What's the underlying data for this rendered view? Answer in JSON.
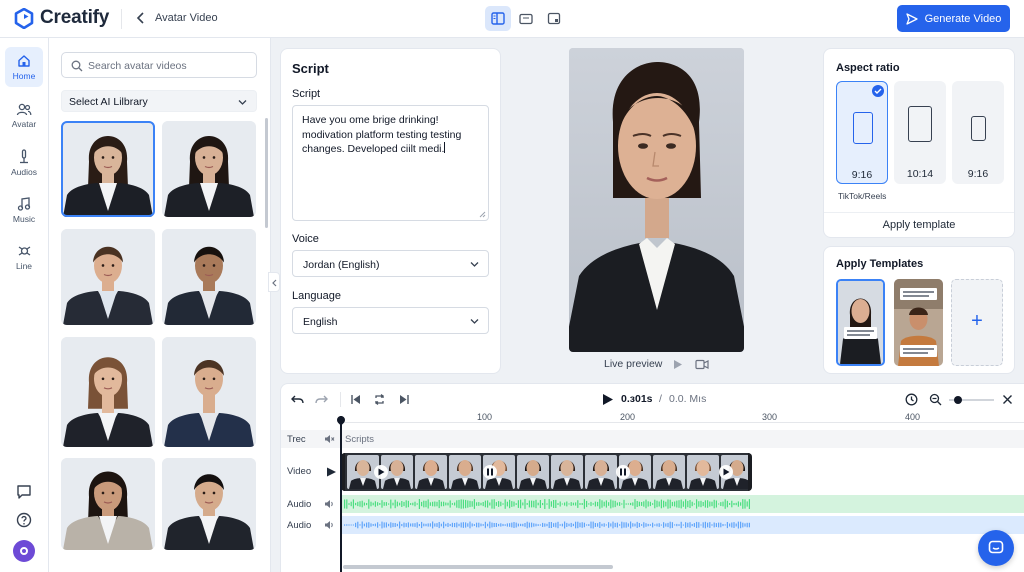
{
  "app": {
    "brand": "Creatify",
    "breadcrumb": "Avatar Video",
    "generate_label": "Generate Video"
  },
  "colors": {
    "accent": "#2563eb",
    "accent_light": "#e6effd",
    "audio_green": "#4ade80",
    "audio_blue": "#60a5fa"
  },
  "rail": {
    "items": [
      {
        "label": "Home",
        "icon": "home-icon",
        "active": true
      },
      {
        "label": "Avatar",
        "icon": "users-icon"
      },
      {
        "label": "Audios",
        "icon": "microphone-icon"
      },
      {
        "label": "Music",
        "icon": "music-note-icon"
      },
      {
        "label": "Line",
        "icon": "line-icon"
      }
    ],
    "bottom_icons": [
      "chat-icon",
      "help-icon",
      "profile-icon"
    ]
  },
  "library": {
    "search_placeholder": "Search avatar videos",
    "select_label": "Select AI Lilbrary",
    "avatars": [
      {
        "skin": "#d9b59a",
        "hair": "#2a1c15",
        "suit": "#1c1f26",
        "shirt": "#f3f4f6",
        "long_hair": true
      },
      {
        "skin": "#d8b196",
        "hair": "#1f1612",
        "suit": "#1d2027",
        "shirt": "#f3f4f6",
        "long_hair": true
      },
      {
        "skin": "#dcae8f",
        "hair": "#4a3222",
        "suit": "#262b36",
        "shirt": "#dfe6ee",
        "long_hair": false
      },
      {
        "skin": "#a97a5a",
        "hair": "#17110e",
        "suit": "#222936",
        "shirt": "#e5e7eb",
        "long_hair": false
      },
      {
        "skin": "#e2b99c",
        "hair": "#7a5237",
        "suit": "#1f222a",
        "shirt": "#f3f4f6",
        "long_hair": true
      },
      {
        "skin": "#d9ad8e",
        "hair": "#4c3424",
        "suit": "#23304a",
        "shirt": "#e5e7eb",
        "long_hair": false
      },
      {
        "skin": "#c99a7b",
        "hair": "#1d1410",
        "suit": "#b9b2a8",
        "shirt": "#f3f4f6",
        "long_hair": true
      },
      {
        "skin": "#d5ab8c",
        "hair": "#141010",
        "suit": "#20242c",
        "shirt": "#f3f4f6",
        "long_hair": false
      }
    ]
  },
  "script_panel": {
    "title": "Script",
    "script_label": "Script",
    "script_text": "Have you ome brige drinking! modivation platform testing testing changes. Developed ciilt medi.",
    "voice_label": "Voice",
    "voice_value": "Jordan (English)",
    "language_label": "Language",
    "language_value": "English"
  },
  "preview": {
    "label": "Live preview"
  },
  "aspect": {
    "title": "Aspect ratio",
    "options": [
      {
        "label": "9:16",
        "selected": true,
        "caption": "TikTok/Reels"
      },
      {
        "label": "10:14",
        "selected": false,
        "caption": ""
      },
      {
        "label": "9:16",
        "selected": false,
        "caption": ""
      }
    ],
    "apply_label": "Apply template"
  },
  "templates": {
    "title": "Apply Templates",
    "add_label": "+"
  },
  "timeline": {
    "time": "0.з01s",
    "separator": "/",
    "duration": "0.0. Mıs",
    "ticks": [
      "100",
      "200",
      "300",
      "400"
    ],
    "zoom_level": 0.2,
    "tracks": [
      {
        "label": "Trec",
        "clip_label": "Scripts",
        "kind": "text"
      },
      {
        "label": "Video",
        "kind": "video"
      },
      {
        "label": "Audio",
        "kind": "audio-green"
      },
      {
        "label": "Audio",
        "kind": "audio-blue"
      }
    ]
  }
}
